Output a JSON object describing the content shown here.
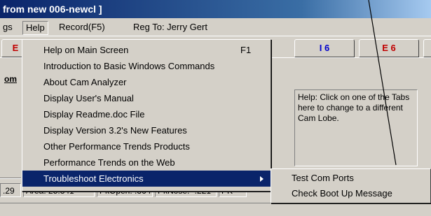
{
  "window": {
    "title": "from new 006-newcl ]"
  },
  "menubar": {
    "items": [
      {
        "label": "gs",
        "open": false
      },
      {
        "label": "Help",
        "open": true
      },
      {
        "label": "Record(F5)",
        "open": false
      },
      {
        "label": "Reg To: Jerry Gert",
        "open": false
      }
    ]
  },
  "tabs": [
    {
      "label": "E",
      "color": "#c00000"
    },
    {
      "label": "I 6",
      "color": "#0000cc"
    },
    {
      "label": "E 6",
      "color": "#c00000"
    },
    {
      "label": "",
      "color": "#000000"
    }
  ],
  "panel": {
    "left_label": "om",
    "help_text": "Help:  Click on one of the Tabs here to change to a different Cam Lobe."
  },
  "status": {
    "cells": [
      ".29",
      "Area: 25.341",
      "PkOpen: .364",
      "PkNose: -.221",
      "PK"
    ]
  },
  "help_menu": {
    "items": [
      {
        "label": "Help on Main Screen",
        "shortcut": "F1"
      },
      {
        "label": "Introduction to Basic Windows Commands",
        "shortcut": ""
      },
      {
        "label": "About Cam Analyzer",
        "shortcut": ""
      },
      {
        "label": "Display User's Manual",
        "shortcut": ""
      },
      {
        "label": "Display Readme.doc File",
        "shortcut": ""
      },
      {
        "label": "Display Version 3.2's New Features",
        "shortcut": ""
      },
      {
        "label": "Other Performance Trends Products",
        "shortcut": ""
      },
      {
        "label": "Performance Trends on the Web",
        "shortcut": ""
      },
      {
        "label": "Troubleshoot Electronics",
        "shortcut": "",
        "selected": true,
        "has_submenu": true
      }
    ]
  },
  "submenu": {
    "items": [
      {
        "label": "Test Com Ports"
      },
      {
        "label": "Check Boot Up Message"
      }
    ]
  },
  "colors": {
    "highlight": "#0a246a",
    "face": "#d4d0c8"
  }
}
